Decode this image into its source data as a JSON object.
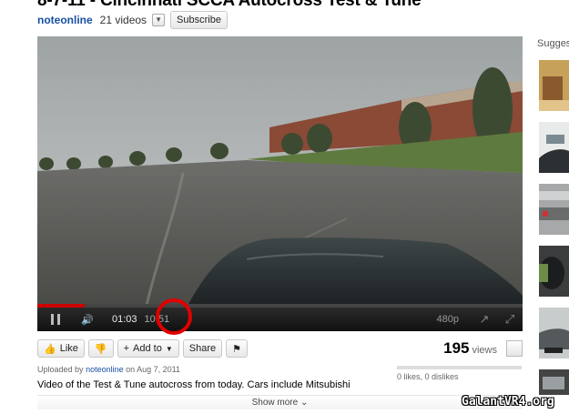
{
  "video": {
    "title": "8-7-11 - Cincinnati SCCA Autocross Test & Tune",
    "channel": "noteonline",
    "video_count": "21 videos",
    "subscribe_label": "Subscribe"
  },
  "player": {
    "current_time": "01:03",
    "duration": "10:51",
    "quality": "480p",
    "progress_fraction": 0.097
  },
  "actions": {
    "like_label": "Like",
    "add_label": "Add to",
    "share_label": "Share",
    "view_count": "195",
    "views_label": "views",
    "likes_text": "0 likes, 0 dislikes"
  },
  "meta": {
    "uploaded_prefix": "Uploaded by",
    "uploader": "noteonline",
    "uploaded_date": "on Aug 7, 2011",
    "description": "Video of the Test & Tune autocross from today. Cars include Mitsubishi",
    "show_more": "Show more"
  },
  "sidebar": {
    "title": "Sugges"
  },
  "watermark": "GalantVR4.org",
  "colors": {
    "accent_red": "#cc0000",
    "link_blue": "#1a4fa3",
    "annotation_circle": "#e00000"
  }
}
